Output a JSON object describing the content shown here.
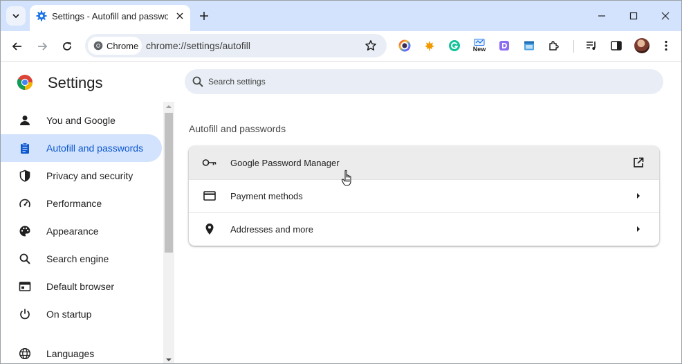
{
  "browser": {
    "tab": {
      "title": "Settings - Autofill and passwords",
      "new_tab_symbol": "+"
    },
    "window_controls": [
      "minimize",
      "maximize",
      "close"
    ],
    "omnibox": {
      "chip_label": "Chrome",
      "url": "chrome://settings/autofill"
    },
    "extensions": [
      {
        "name": "colorful-circle-extension-icon",
        "badge": ""
      },
      {
        "name": "maple-leaf-extension-icon",
        "badge": ""
      },
      {
        "name": "grammarly-extension-icon",
        "badge": ""
      },
      {
        "name": "new-badge-extension-icon",
        "badge": "New"
      },
      {
        "name": "purple-d-extension-icon",
        "badge": ""
      },
      {
        "name": "calendar-extension-icon",
        "badge": ""
      },
      {
        "name": "puzzle-extensions-icon",
        "badge": ""
      }
    ]
  },
  "sidebar": {
    "title": "Settings",
    "items": [
      {
        "label": "You and Google",
        "icon": "person-icon",
        "active": false
      },
      {
        "label": "Autofill and passwords",
        "icon": "clipboard-icon",
        "active": true
      },
      {
        "label": "Privacy and security",
        "icon": "shield-icon",
        "active": false
      },
      {
        "label": "Performance",
        "icon": "speedometer-icon",
        "active": false
      },
      {
        "label": "Appearance",
        "icon": "palette-icon",
        "active": false
      },
      {
        "label": "Search engine",
        "icon": "search-icon",
        "active": false
      },
      {
        "label": "Default browser",
        "icon": "browser-window-icon",
        "active": false
      },
      {
        "label": "On startup",
        "icon": "power-icon",
        "active": false
      },
      {
        "label": "Languages",
        "icon": "globe-icon",
        "active": false
      }
    ]
  },
  "main": {
    "search_placeholder": "Search settings",
    "section_title": "Autofill and passwords",
    "rows": [
      {
        "label": "Google Password Manager",
        "icon": "key-icon",
        "trailing": "open-in-new-icon"
      },
      {
        "label": "Payment methods",
        "icon": "credit-card-icon",
        "trailing": "arrow-right-icon"
      },
      {
        "label": "Addresses and more",
        "icon": "location-pin-icon",
        "trailing": "arrow-right-icon"
      }
    ]
  },
  "colors": {
    "accent": "#0b57d0",
    "active_bg": "#d3e3fd",
    "tabstrip_bg": "#d3e3fd",
    "search_bg": "#e9eef6"
  }
}
